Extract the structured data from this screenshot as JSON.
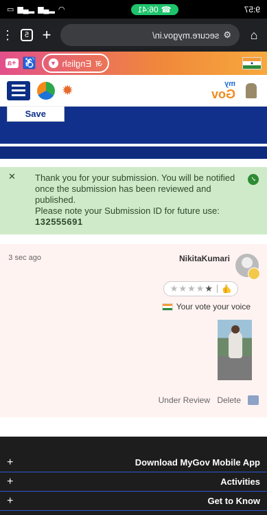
{
  "status_bar": {
    "time": "9:57",
    "timer": "06:41"
  },
  "browser": {
    "url": "secure.mygov.in/",
    "tab_count": "5"
  },
  "lang_bar": {
    "language": "English"
  },
  "header": {
    "logo_text_top": "my",
    "logo_text_main": "Gov"
  },
  "form": {
    "save_label": "Save"
  },
  "alert": {
    "message": "Thank you for your submission. You will be notified once the submission has been reviewed and published.",
    "id_prefix": "Please note your Submission ID for future use:",
    "submission_id": "132555691"
  },
  "submission": {
    "username": "NikitaKumari",
    "time": "3 sec ago",
    "voice_text": "Your vote your voice",
    "delete_label": "Delete",
    "status": "Under Review",
    "rating": 1
  },
  "footer": {
    "items": [
      {
        "label": "Download MyGov Mobile App"
      },
      {
        "label": "Activities"
      },
      {
        "label": "Get to Know"
      }
    ]
  }
}
